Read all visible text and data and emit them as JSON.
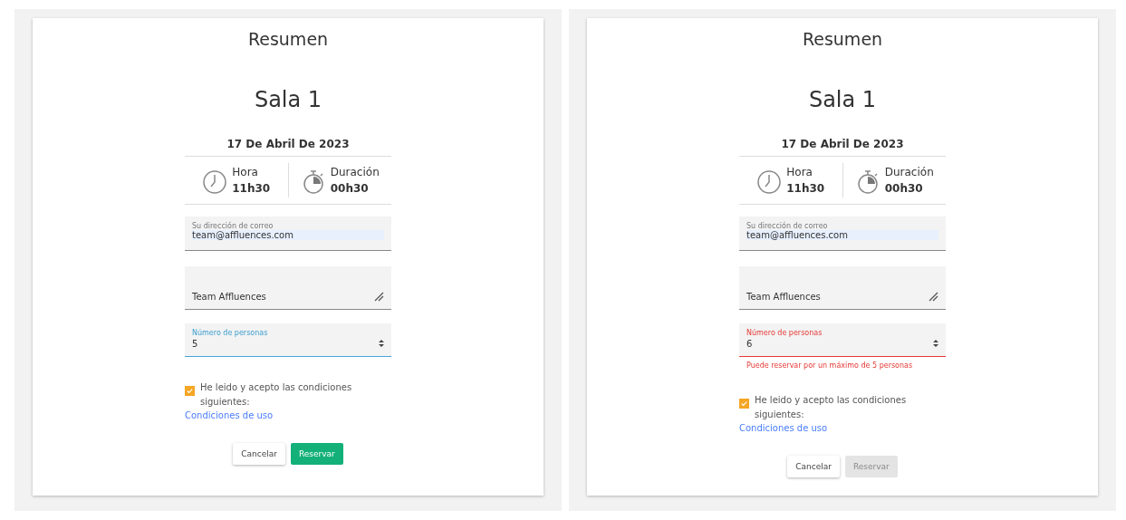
{
  "panels": [
    {
      "title": "Resumen",
      "room": "Sala 1",
      "date": "17 De Abril De 2023",
      "time": {
        "label": "Hora",
        "value": "11h30"
      },
      "duration": {
        "label": "Duración",
        "value": "00h30"
      },
      "email": {
        "label": "Su dirección de correo",
        "value": "team@affluences.com"
      },
      "name": {
        "value": "Team Affluences"
      },
      "persons": {
        "label": "Número de personas",
        "value": "5",
        "focused": true,
        "invalid": false
      },
      "consent": {
        "checked": true,
        "text": "He leido y acepto las condiciones siguientes:",
        "link": "Condiciones de uso"
      },
      "buttons": {
        "cancel": "Cancelar",
        "reserve": {
          "label": "Reservar",
          "disabled": false
        }
      }
    },
    {
      "title": "Resumen",
      "room": "Sala 1",
      "date": "17 De Abril De 2023",
      "time": {
        "label": "Hora",
        "value": "11h30"
      },
      "duration": {
        "label": "Duración",
        "value": "00h30"
      },
      "email": {
        "label": "Su dirección de correo",
        "value": "team@affluences.com"
      },
      "name": {
        "value": "Team Affluences"
      },
      "persons": {
        "label": "Número de personas",
        "value": "6",
        "focused": false,
        "invalid": true,
        "error": "Puede reservar por un máximo de 5 personas"
      },
      "consent": {
        "checked": true,
        "text": "He leido y acepto las condiciones siguientes:",
        "link": "Condiciones de uso"
      },
      "buttons": {
        "cancel": "Cancelar",
        "reserve": {
          "label": "Reservar",
          "disabled": true
        }
      }
    }
  ]
}
